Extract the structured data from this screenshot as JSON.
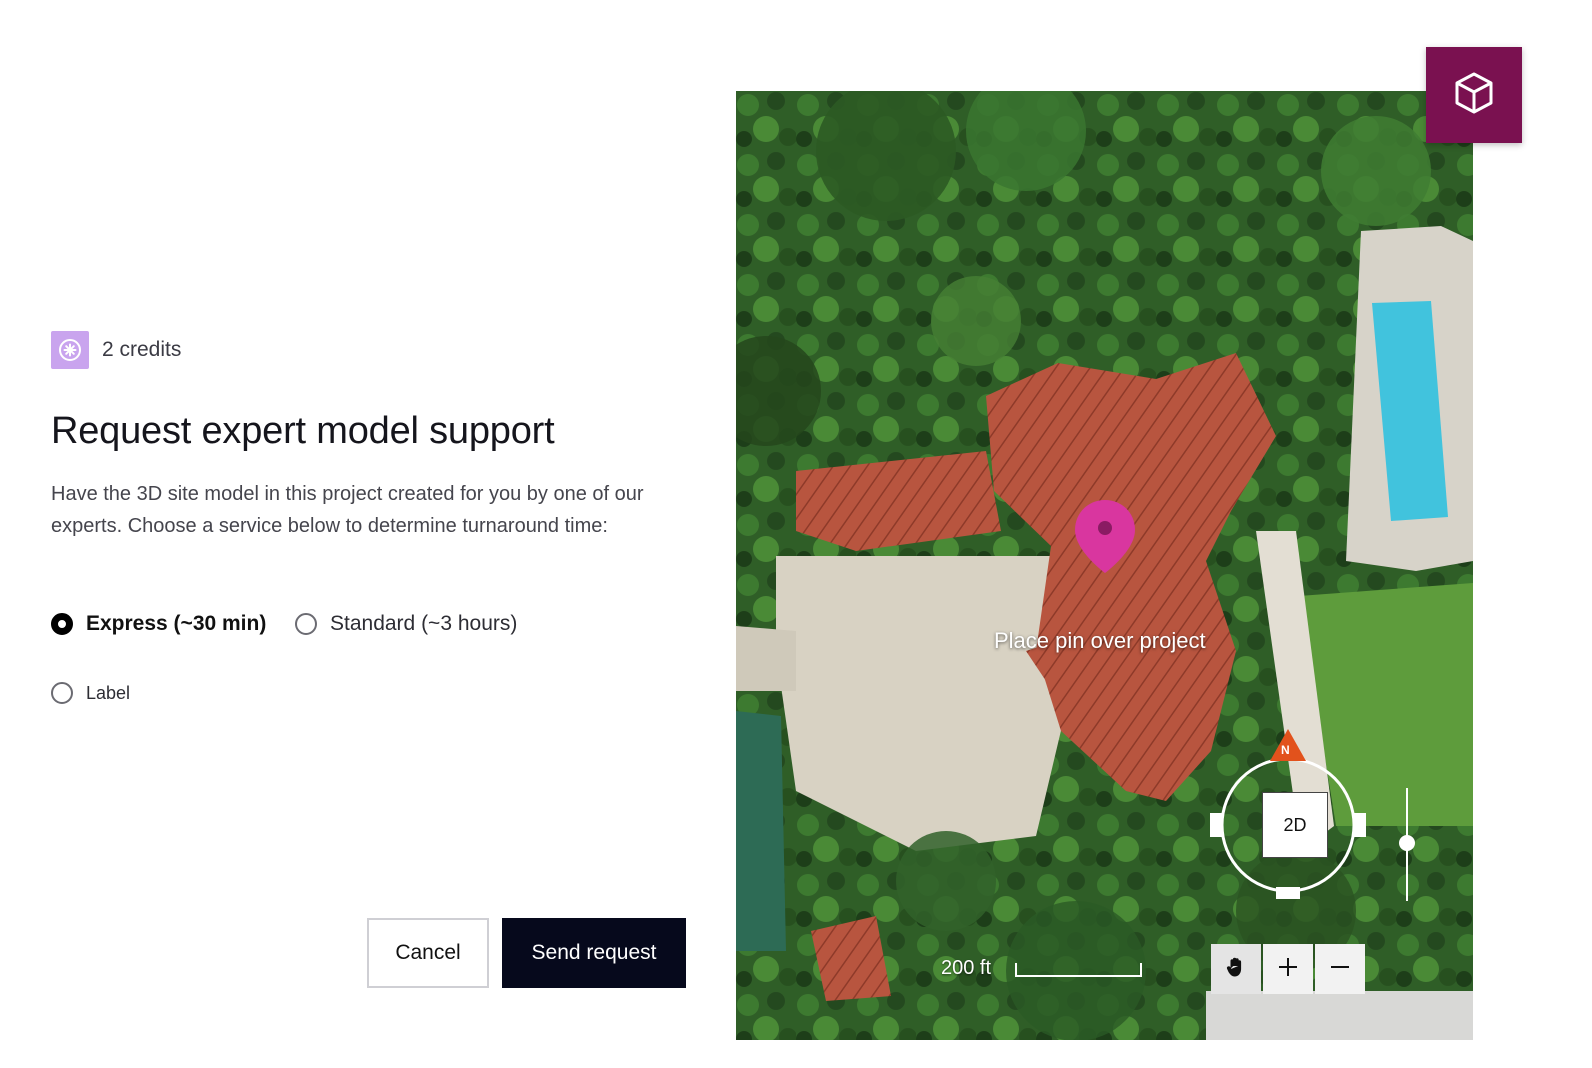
{
  "credits": {
    "icon": "sparkle-icon",
    "text": "2 credits",
    "icon_bg": "#c9a4ee"
  },
  "dialog": {
    "title": "Request expert model support",
    "description": "Have the 3D site model in this project created for you by one of our experts. Choose a service below to determine turnaround time:",
    "options": [
      {
        "label": "Express (~30 min)",
        "checked": true
      },
      {
        "label": "Standard (~3 hours)",
        "checked": false
      },
      {
        "label": "Label",
        "checked": false
      }
    ],
    "cancel_label": "Cancel",
    "send_label": "Send request"
  },
  "map": {
    "hint": "Place pin over project",
    "scale_label": "200 ft",
    "compass_mode": "2D",
    "compass_north": "N",
    "view_toggle_icon": "cube-icon",
    "tools": [
      {
        "icon": "hand-icon"
      },
      {
        "icon": "plus-icon"
      },
      {
        "icon": "minus-icon"
      }
    ]
  },
  "colors": {
    "accent": "#7a1150",
    "primary_button": "#06091c",
    "pin": "#d9369f",
    "north_marker": "#e2521c"
  }
}
